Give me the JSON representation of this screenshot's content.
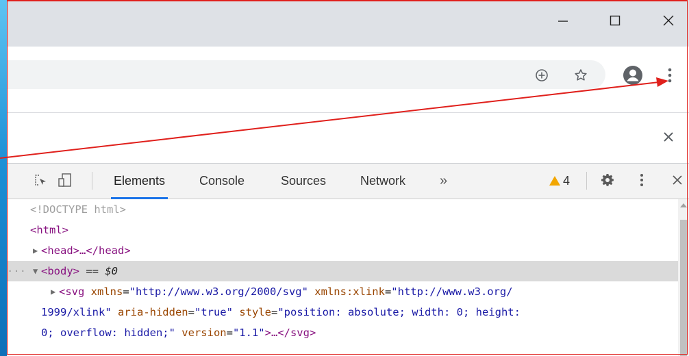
{
  "window": {
    "controls": {
      "minimize": "minimize",
      "maximize": "maximize",
      "close": "close"
    }
  },
  "toolbar": {
    "icons": [
      "add-circle-icon",
      "star-icon",
      "account-icon",
      "more-vert-icon"
    ]
  },
  "devtools": {
    "tabs": [
      {
        "label": "Elements",
        "active": true
      },
      {
        "label": "Console",
        "active": false
      },
      {
        "label": "Sources",
        "active": false
      },
      {
        "label": "Network",
        "active": false
      }
    ],
    "more_tabs": "»",
    "warnings_count": "4",
    "dom": {
      "doctype": "<!DOCTYPE html>",
      "html_open": "<html>",
      "head_collapsed": "<head>…</head>",
      "body_open": "<body>",
      "body_eq": " == ",
      "body_ref": "$0",
      "ellipsis": "···",
      "svg_tag": "<svg",
      "svg_xmlns_name": " xmlns",
      "svg_xmlns_val": "\"http://www.w3.org/2000/svg\"",
      "svg_xlink_name": " xmlns:xlink",
      "svg_xlink_val_part1": "\"http://www.w3.org/",
      "svg_xlink_val_part2": "1999/xlink\"",
      "svg_aria_name": " aria-hidden",
      "svg_aria_val": "\"true\"",
      "svg_style_name": " style",
      "svg_style_val_part1": "\"position: absolute; width: 0; height:",
      "svg_style_val_part2": "0; overflow: hidden;\"",
      "svg_version_name": " version",
      "svg_version_val": "\"1.1\"",
      "svg_close": ">…</svg>"
    }
  },
  "colors": {
    "annotation": "#e0201c",
    "active_tab": "#1a73e8",
    "warning": "#f2a600"
  }
}
